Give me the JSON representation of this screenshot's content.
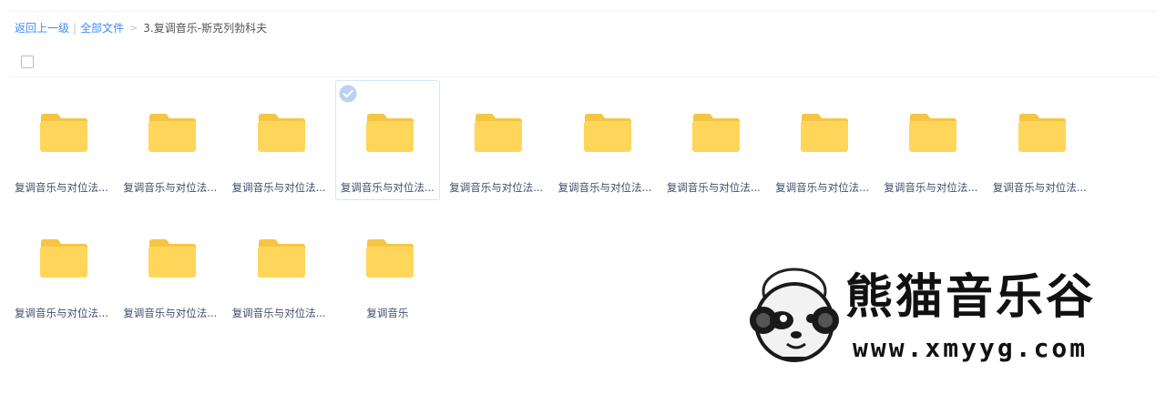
{
  "breadcrumb": {
    "back": "返回上一级",
    "all_files": "全部文件",
    "separator": ">",
    "current": "3.复调音乐-斯克列勃科夫"
  },
  "files": [
    {
      "name": "复调音乐与对位法...",
      "selected": false
    },
    {
      "name": "复调音乐与对位法...",
      "selected": false
    },
    {
      "name": "复调音乐与对位法...",
      "selected": false
    },
    {
      "name": "复调音乐与对位法...",
      "selected": true
    },
    {
      "name": "复调音乐与对位法...",
      "selected": false
    },
    {
      "name": "复调音乐与对位法...",
      "selected": false
    },
    {
      "name": "复调音乐与对位法...",
      "selected": false
    },
    {
      "name": "复调音乐与对位法...",
      "selected": false
    },
    {
      "name": "复调音乐与对位法...",
      "selected": false
    },
    {
      "name": "复调音乐与对位法...",
      "selected": false
    },
    {
      "name": "复调音乐与对位法...",
      "selected": false
    },
    {
      "name": "复调音乐与对位法...",
      "selected": false
    },
    {
      "name": "复调音乐与对位法...",
      "selected": false
    },
    {
      "name": "复调音乐",
      "selected": false
    }
  ],
  "watermark": {
    "title": "熊猫音乐谷",
    "url": "www.xmyyg.com"
  },
  "colors": {
    "link": "#3b8cff",
    "folder_body": "#ffd659",
    "folder_tab": "#f5c543",
    "label": "#424e67",
    "selected_border": "#d4e6fb",
    "check_badge": "#b9d2f2"
  },
  "icons": {
    "folder": "folder-icon",
    "check": "check-circle-icon",
    "checkbox": "checkbox-icon"
  }
}
